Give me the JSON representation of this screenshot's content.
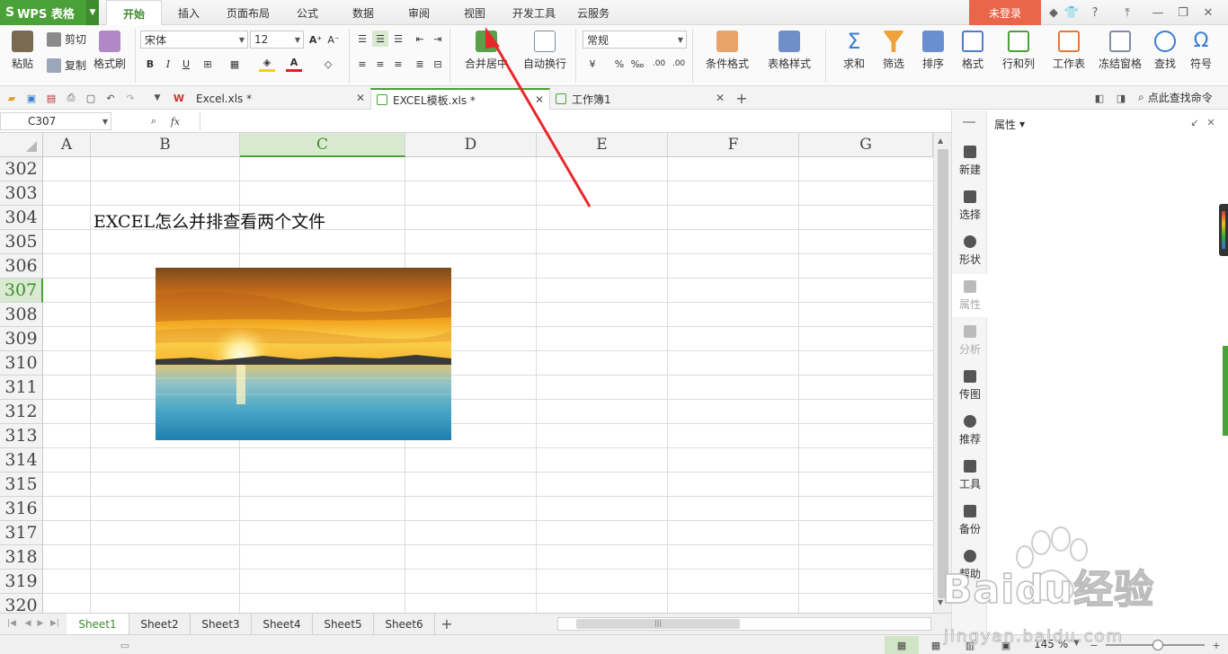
{
  "app": {
    "name": "WPS 表格"
  },
  "menu": {
    "tabs": [
      "开始",
      "插入",
      "页面布局",
      "公式",
      "数据",
      "审阅",
      "视图",
      "开发工具",
      "云服务"
    ],
    "active_tab": "开始",
    "login": "未登录"
  },
  "ribbon": {
    "paste": "粘贴",
    "cut": "剪切",
    "copy": "复制",
    "format_painter": "格式刷",
    "font_name": "宋体",
    "font_size": "12",
    "bold": "B",
    "italic": "I",
    "underline": "U",
    "merge_center": "合并居中",
    "wrap_text": "自动换行",
    "number_format": "常规",
    "percent": "%",
    "comma": "‰",
    "inc_decimal": ".00",
    "dec_decimal": ".00",
    "cond_format": "条件格式",
    "table_style": "表格样式",
    "sum": "求和",
    "filter": "筛选",
    "sort": "排序",
    "format": "格式",
    "rows_cols": "行和列",
    "worksheet": "工作表",
    "freeze": "冻结窗格",
    "find": "查找",
    "symbol": "符号"
  },
  "doc_tabs": [
    {
      "label": "Excel.xls *"
    },
    {
      "label": "EXCEL模板.xls *"
    },
    {
      "label": "工作簿1"
    }
  ],
  "quick_search": "点此查找命令",
  "formula_bar": {
    "name_box": "C307",
    "fx": "fx",
    "formula": ""
  },
  "grid": {
    "columns": [
      "A",
      "B",
      "C",
      "D",
      "E",
      "F",
      "G"
    ],
    "selected_column": "C",
    "rows": [
      "302",
      "303",
      "304",
      "305",
      "306",
      "307",
      "308",
      "309",
      "310",
      "311",
      "312",
      "313",
      "314",
      "315",
      "316",
      "317",
      "318",
      "319",
      "320"
    ],
    "selected_row": "307",
    "cell_b304": "EXCEL怎么并排查看两个文件"
  },
  "sheets": [
    "Sheet1",
    "Sheet2",
    "Sheet3",
    "Sheet4",
    "Sheet5",
    "Sheet6"
  ],
  "active_sheet": "Sheet1",
  "side_panel": {
    "title": "属性",
    "items": [
      "新建",
      "选择",
      "形状",
      "属性",
      "分析",
      "传图",
      "推荐",
      "工具",
      "备份",
      "帮助"
    ]
  },
  "status": {
    "zoom": "145 %"
  },
  "watermark": {
    "brand": "Baidu经验",
    "url": "jingyan.baidu.com"
  },
  "colors": {
    "accent": "#4aa137",
    "login": "#e9664a",
    "arrow": "#e8282b"
  }
}
